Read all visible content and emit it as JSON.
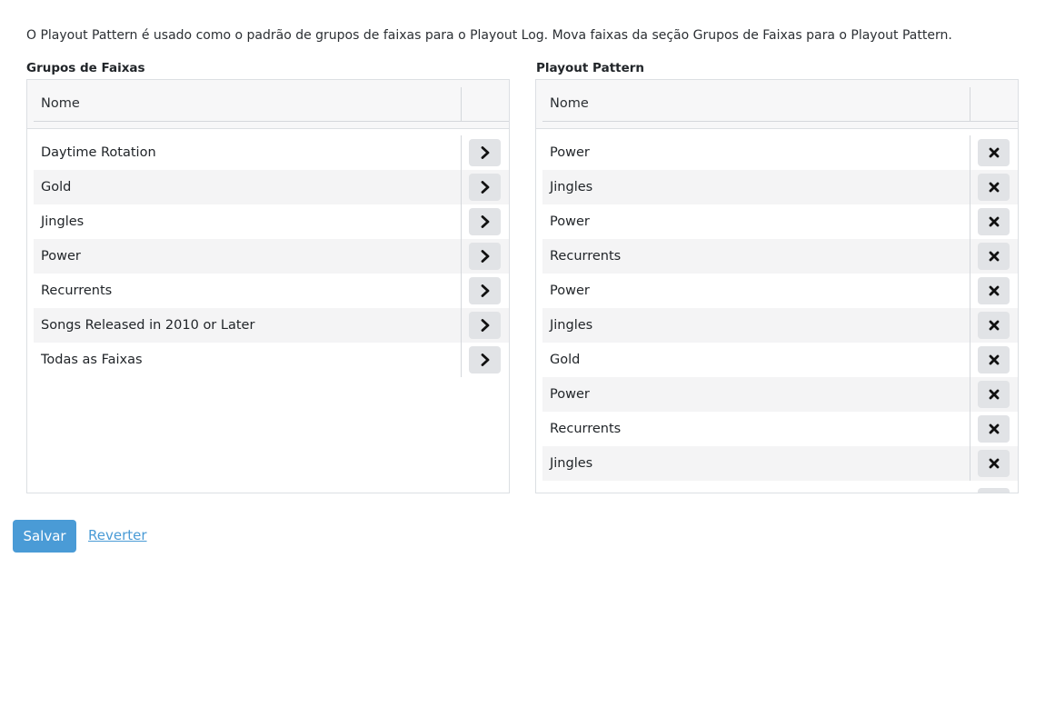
{
  "intro_text": "O Playout Pattern é usado como o padrão de grupos de faixas para o Playout Log. Mova faixas da seção Grupos de Faixas para o Playout Pattern.",
  "groups": {
    "title": "Grupos de Faixas",
    "column_header": "Nome",
    "action_icon": "chevron-right-icon",
    "items": [
      "Daytime Rotation",
      "Gold",
      "Jingles",
      "Power",
      "Recurrents",
      "Songs Released in 2010 or Later",
      "Todas as Faixas"
    ]
  },
  "pattern": {
    "title": "Playout Pattern",
    "column_header": "Nome",
    "action_icon": "remove-icon",
    "items": [
      "Power",
      "Jingles",
      "Power",
      "Recurrents",
      "Power",
      "Jingles",
      "Gold",
      "Power",
      "Recurrents",
      "Jingles"
    ]
  },
  "actions": {
    "save_label": "Salvar",
    "revert_label": "Reverter"
  },
  "colors": {
    "accent": "#4a9bd6",
    "row_alt": "#f4f4f5",
    "button_bg": "#e1e3e6"
  }
}
